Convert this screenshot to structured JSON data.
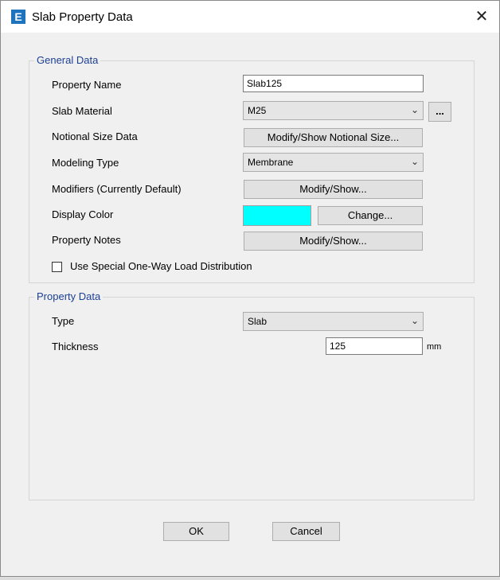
{
  "window": {
    "title": "Slab Property Data",
    "app_icon_letter": "E",
    "close_glyph": "✕"
  },
  "general": {
    "title": "General Data",
    "property_name_label": "Property Name",
    "property_name_value": "Slab125",
    "slab_material_label": "Slab Material",
    "slab_material_value": "M25",
    "slab_material_more": "...",
    "notional_label": "Notional Size Data",
    "notional_button": "Modify/Show Notional Size...",
    "modeling_label": "Modeling Type",
    "modeling_value": "Membrane",
    "modifiers_label": "Modifiers (Currently Default)",
    "modifiers_button": "Modify/Show...",
    "display_color_label": "Display Color",
    "display_color_value": "#00ffff",
    "change_button": "Change...",
    "notes_label": "Property Notes",
    "notes_button": "Modify/Show...",
    "one_way_label": "Use Special One-Way Load Distribution",
    "one_way_checked": false
  },
  "property": {
    "title": "Property Data",
    "type_label": "Type",
    "type_value": "Slab",
    "thickness_label": "Thickness",
    "thickness_value": "125",
    "thickness_unit": "mm"
  },
  "footer": {
    "ok": "OK",
    "cancel": "Cancel"
  },
  "icons": {
    "dropdown": "chevron-down-icon"
  }
}
